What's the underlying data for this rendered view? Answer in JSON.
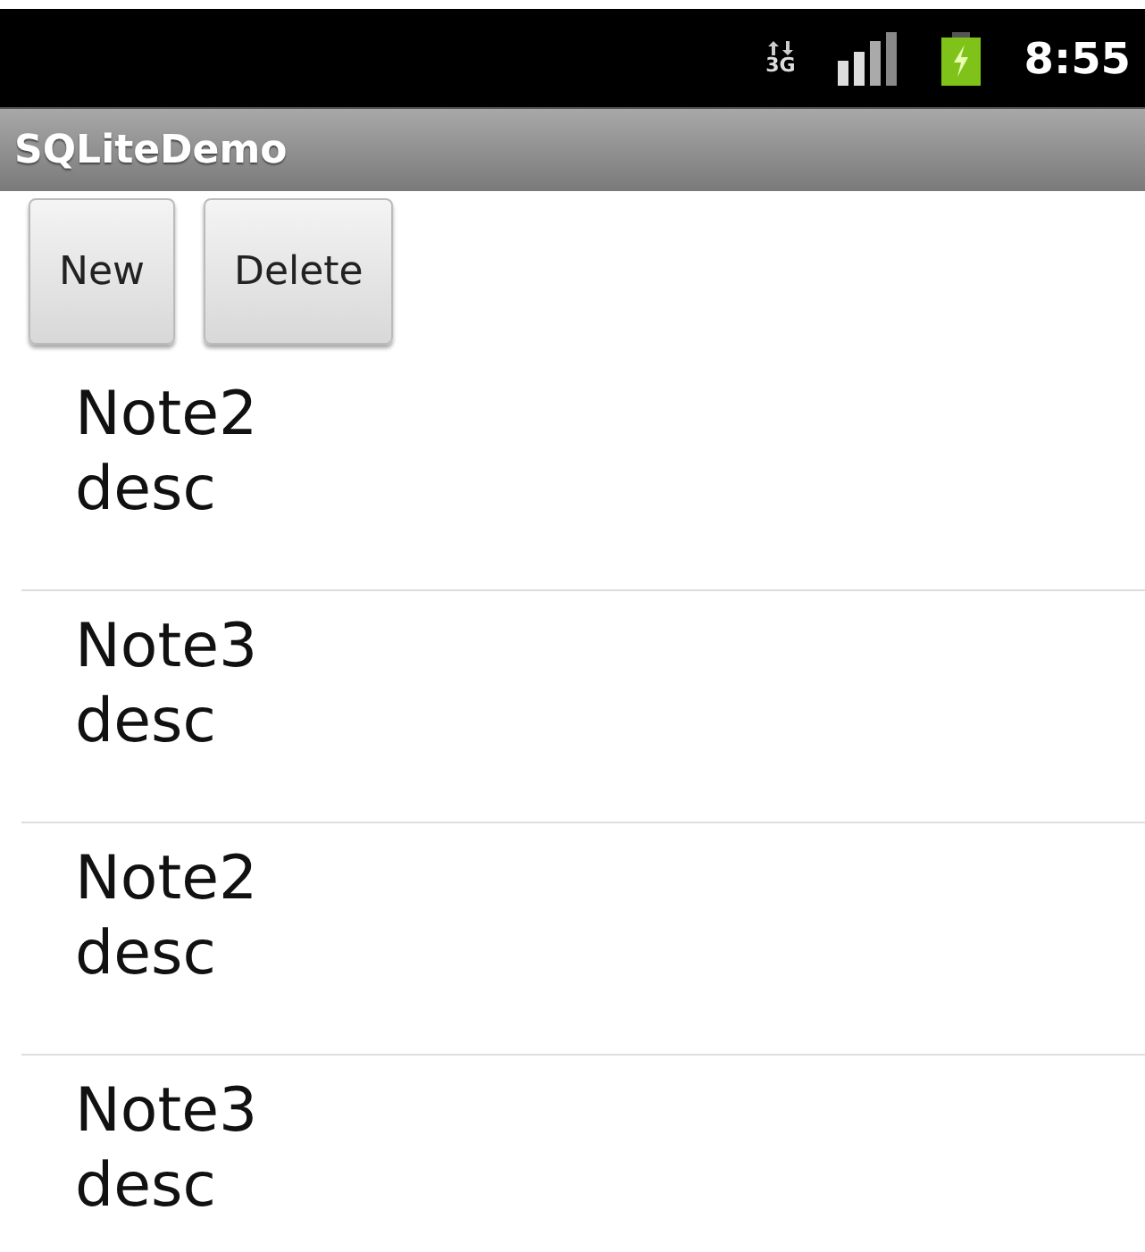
{
  "status_bar": {
    "network": "3G",
    "time": "8:55"
  },
  "title_bar": {
    "title": "SQLiteDemo"
  },
  "buttons": [
    {
      "label": "New"
    },
    {
      "label": "Delete"
    }
  ],
  "notes": [
    {
      "title": "Note2",
      "description": "desc"
    },
    {
      "title": "Note3",
      "description": "desc"
    },
    {
      "title": "Note2",
      "description": "desc"
    },
    {
      "title": "Note3",
      "description": "desc"
    }
  ]
}
